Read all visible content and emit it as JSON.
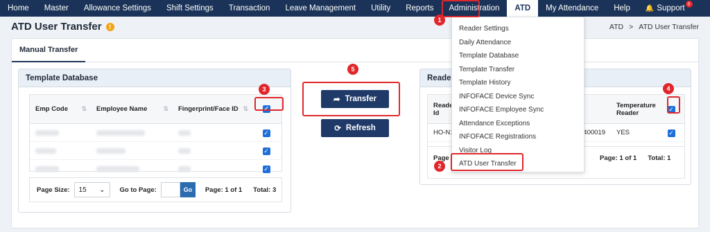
{
  "nav": {
    "items": [
      "Home",
      "Master",
      "Allowance Settings",
      "Shift Settings",
      "Transaction",
      "Leave Management",
      "Utility",
      "Reports",
      "Administration",
      "ATD",
      "My Attendance",
      "Help",
      "Support"
    ],
    "support_badge": "0"
  },
  "page": {
    "title": "ATD User Transfer",
    "info_icon": "!"
  },
  "breadcrumb": {
    "root": "ATD",
    "sep": ">",
    "current": "ATD User Transfer"
  },
  "tabs": {
    "active": "Manual Transfer"
  },
  "template_db": {
    "title": "Template Database",
    "columns": [
      "Emp Code",
      "Employee Name",
      "Fingerprint/Face ID"
    ],
    "pager": {
      "page_size_label": "Page Size:",
      "page_size": "15",
      "goto_label": "Go to Page:",
      "go": "Go",
      "page_info": "Page: 1 of 1",
      "total": "Total: 3"
    }
  },
  "actions": {
    "transfer": "Transfer",
    "refresh": "Refresh"
  },
  "reader": {
    "title": "Reader",
    "col_id_1": "Reader",
    "col_id_2": "Id",
    "col_temp_1": "Temperature",
    "col_temp_2": "Reader",
    "row_id": "HO-N1",
    "row_serial": "400019",
    "row_temp": "YES",
    "pager_label": "Page",
    "page_info": "Page: 1 of 1",
    "total": "Total: 1"
  },
  "dropdown": {
    "items": [
      "Reader Settings",
      "Daily Attendance",
      "Template Database",
      "Template Transfer",
      "Template History",
      "INFOFACE Device Sync",
      "INFOFACE Employee Sync",
      "Attendance Exceptions",
      "INFOFACE Registrations",
      "Visitor Log",
      "ATD User Transfer"
    ]
  },
  "steps": [
    "1",
    "2",
    "3",
    "4",
    "5"
  ],
  "colors": {
    "nav_bg": "#1b3358",
    "button_bg": "#1f3a68",
    "annotation_red": "#e0262b",
    "checkbox_blue": "#1e6fd9"
  },
  "icons": {
    "transfer": "share-arrow-icon",
    "refresh": "refresh-icon",
    "support": "bell-icon",
    "sort": "sort-icon",
    "info": "info-icon"
  }
}
